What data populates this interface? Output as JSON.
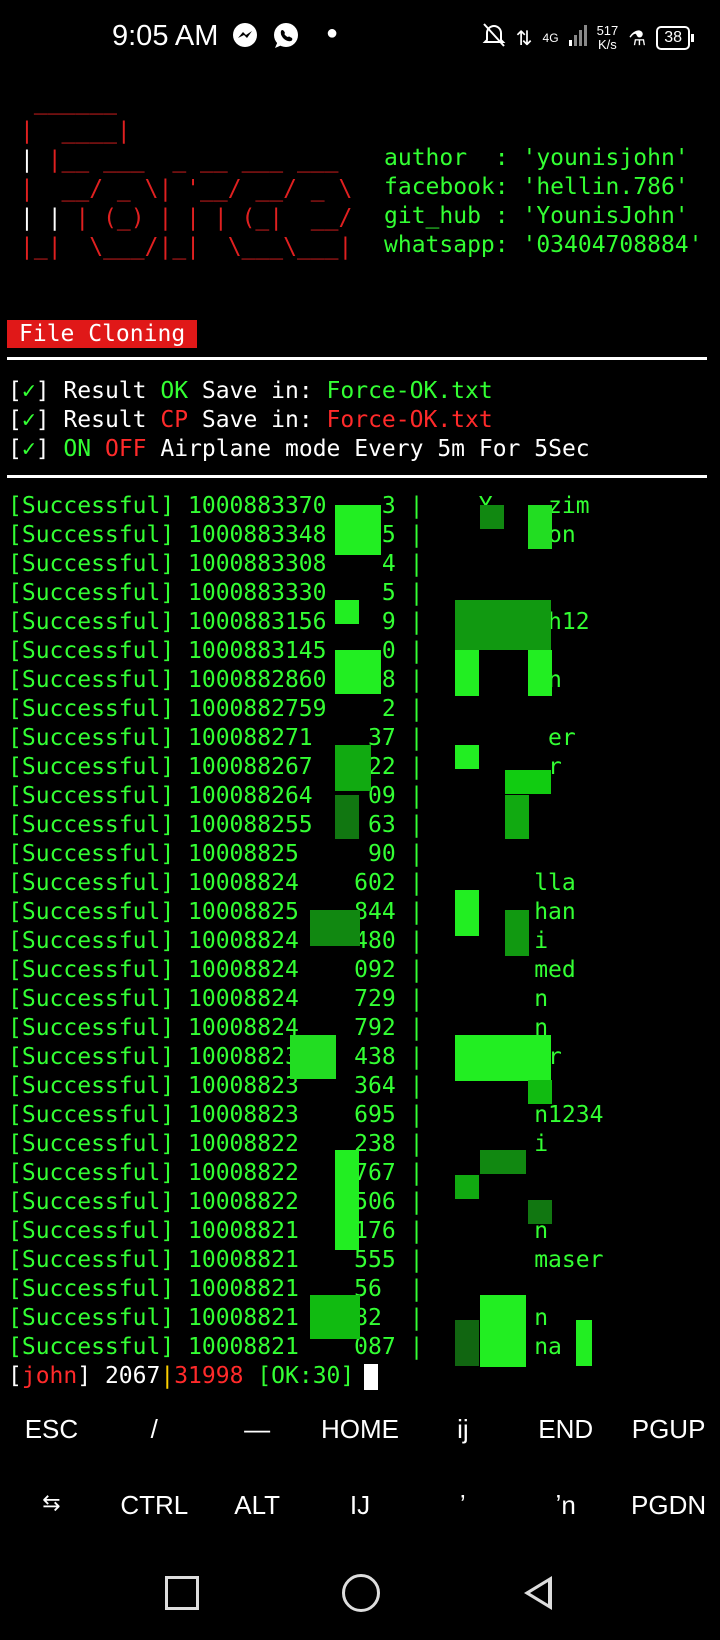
{
  "status": {
    "time": "9:05 AM",
    "net_type": "4G",
    "net_speed_value": "517",
    "net_speed_unit": "K/s",
    "battery": "38"
  },
  "banner": {
    "info_lines": [
      "author  : 'younisjohn'",
      "facebook: 'hellin.786'",
      "git_hub : 'YounisJohn'",
      "whatsapp: '03404708884'"
    ]
  },
  "section_title": "File Cloning",
  "messages": {
    "line1": {
      "mark": "✓",
      "pre": "Result ",
      "status": "OK",
      "mid": " Save in: ",
      "file": "Force-OK.txt"
    },
    "line2": {
      "mark": "✓",
      "pre": "Result ",
      "status": "CP",
      "mid": " Save in: ",
      "file": "Force-OK.txt"
    },
    "line3": {
      "mark": "✓",
      "on": "ON",
      "off": "OFF",
      "rest": " Airplane mode Every 5m For 5Sec"
    }
  },
  "log_rows": [
    "[Successful] 1000883370    3 |    Y    zim",
    "[Successful] 1000883348    5 |         on",
    "[Successful] 1000883308    4 |",
    "[Successful] 1000883330    5 |",
    "[Successful] 1000883156    9 |         h12",
    "[Successful] 1000883145    0 |",
    "[Successful] 1000882860    8 |         n",
    "[Successful] 1000882759    2 |",
    "[Successful] 100088271    37 |         er",
    "[Successful] 100088267    22 |         r",
    "[Successful] 100088264    09 |",
    "[Successful] 100088255    63 |",
    "[Successful] 10008825     90 |",
    "[Successful] 10008824    602 |        lla",
    "[Successful] 10008825    844 |        han",
    "[Successful] 10008824    480 |        i",
    "[Successful] 10008824    092 |        med",
    "[Successful] 10008824    729 |        n",
    "[Successful] 10008824    792 |        n",
    "[Successful] 10008823    438 |        ar",
    "[Successful] 10008823    364 |",
    "[Successful] 10008823    695 |        n1234",
    "[Successful] 10008822    238 |        i",
    "[Successful] 10008822    767 |",
    "[Successful] 10008822    506 |",
    "[Successful] 10008821    176 |        n",
    "[Successful] 10008821    555 |        maser",
    "[Successful] 10008821    56  |",
    "[Successful] 10008821    82  |        n",
    "[Successful] 10008821    087 |        na"
  ],
  "prompt": {
    "user": "john",
    "count": "2067",
    "total": "31998",
    "ok": "[OK:30]"
  },
  "keys_row1": [
    "ESC",
    "/",
    "—",
    "HOME",
    "ij",
    "END",
    "PGUP"
  ],
  "keys_row2": [
    "⇆",
    "CTRL",
    "ALT",
    "IJ",
    "ʼ",
    "ʼn",
    "PGDN"
  ],
  "colors": {
    "green": "#33ff33",
    "red": "#ff2a2a",
    "badge": "#e01818"
  }
}
